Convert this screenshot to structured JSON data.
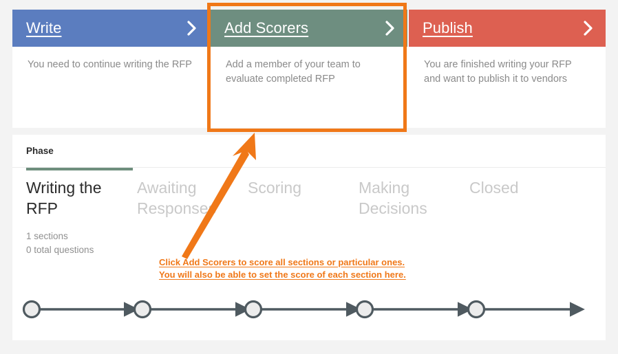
{
  "cards": [
    {
      "title": "Write",
      "description": "You need to continue writing the RFP",
      "header_color": "#5b7dbf",
      "chevron": "chevron-right"
    },
    {
      "title": "Add Scorers",
      "description": "Add a member of your team to evaluate completed RFP",
      "header_color": "#6e8e80",
      "chevron": "chevron-right"
    },
    {
      "title": "Publish",
      "description": "You are finished writing your RFP and want to publish it to vendors",
      "header_color": "#dd6051",
      "chevron": "chevron-right"
    }
  ],
  "highlight": {
    "color": "#f07818",
    "target": "Add Scorers"
  },
  "phase_section": {
    "label": "Phase",
    "active_underline_color": "#6e8e7d",
    "tabs": [
      {
        "name": "Writing the RFP",
        "active": true,
        "meta_line1": "1 sections",
        "meta_line2": "0 total questions"
      },
      {
        "name": "Awaiting Responses",
        "active": false,
        "meta_line1": "",
        "meta_line2": ""
      },
      {
        "name": "Scoring",
        "active": false,
        "meta_line1": "",
        "meta_line2": ""
      },
      {
        "name": "Making Decisions",
        "active": false,
        "meta_line1": "",
        "meta_line2": ""
      },
      {
        "name": "Closed",
        "active": false,
        "meta_line1": "",
        "meta_line2": ""
      }
    ],
    "progress": {
      "node_count": 5,
      "node_fill": "#ececec",
      "node_stroke": "#4f5a60",
      "line_color": "#4f5a60"
    }
  },
  "annotation": {
    "line1": "Click Add Scorers to score all sections or particular ones.",
    "line2": "You will also be able to set the score of each section here.",
    "color": "#f07818",
    "arrow": "arrow-pointing-up-right"
  }
}
